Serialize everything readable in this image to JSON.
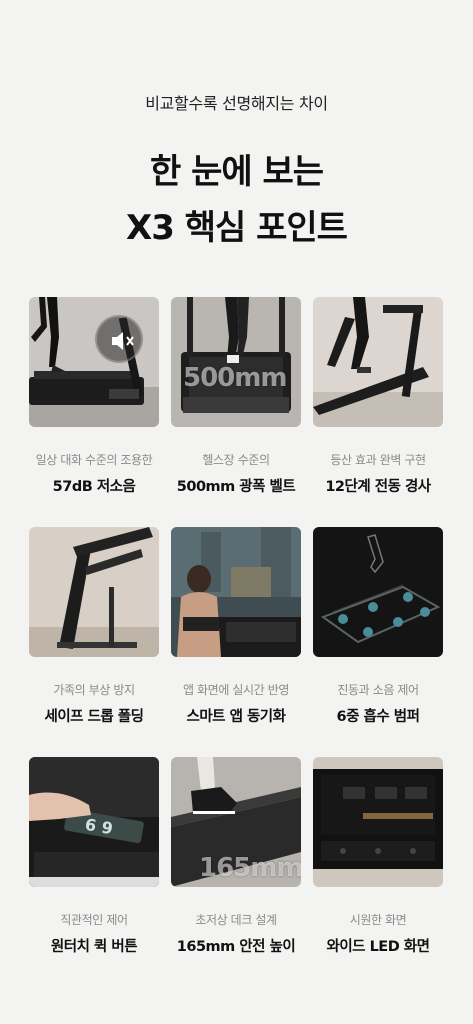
{
  "header": {
    "eyebrow": "비교할수록 선명해지는 차이",
    "title_line1": "한 눈에 보는",
    "title_line2": "X3 핵심 포인트"
  },
  "features": [
    {
      "sub": "일상 대화 수준의 조용한",
      "main": "57dB 저소음",
      "icon": "mute-speaker-icon"
    },
    {
      "sub": "헬스장 수준의",
      "main": "500mm 광폭 벨트",
      "overlay": "500mm"
    },
    {
      "sub": "등산 효과 완벽 구현",
      "main": "12단계 전동 경사"
    },
    {
      "sub": "가족의 부상 방지",
      "main": "세이프 드롭 폴딩"
    },
    {
      "sub": "앱 화면에 실시간 반영",
      "main": "스마트 앱 동기화"
    },
    {
      "sub": "진동과 소음 제어",
      "main": "6중 흡수 범퍼"
    },
    {
      "sub": "직관적인 제어",
      "main": "원터치 퀵 버튼",
      "overlay": "6  9"
    },
    {
      "sub": "초저상 데크 설계",
      "main": "165mm 안전 높이",
      "overlay": "165mm"
    },
    {
      "sub": "시원한 화면",
      "main": "와이드 LED 화면"
    }
  ]
}
